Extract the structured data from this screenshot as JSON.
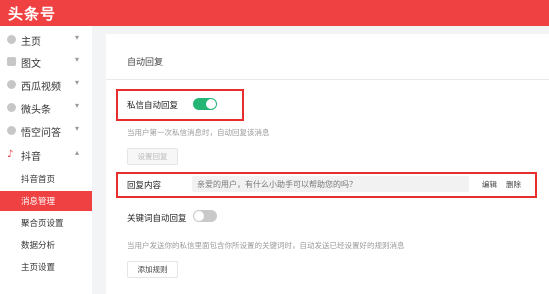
{
  "app": {
    "logo": "头条号"
  },
  "sidebar": {
    "items": [
      {
        "label": "主页",
        "icon": "home-icon",
        "caret": "▾"
      },
      {
        "label": "图文",
        "icon": "article-icon",
        "caret": "▾"
      },
      {
        "label": "西瓜视频",
        "icon": "video-icon",
        "caret": "▾"
      },
      {
        "label": "微头条",
        "icon": "micro-post-icon",
        "caret": "▾"
      },
      {
        "label": "悟空问答",
        "icon": "qa-icon",
        "caret": "▾"
      },
      {
        "label": "抖音",
        "icon": "douyin-icon",
        "caret": "▴"
      }
    ],
    "subitems": [
      {
        "label": "抖音首页",
        "active": false
      },
      {
        "label": "消息管理",
        "active": true
      },
      {
        "label": "聚合页设置",
        "active": false
      },
      {
        "label": "数据分析",
        "active": false
      },
      {
        "label": "主页设置",
        "active": false
      }
    ]
  },
  "main": {
    "title": "自动回复",
    "private_reply": {
      "label": "私信自动回复",
      "enabled": true,
      "hint": "当用户第一次私信消息时，自动回复该消息",
      "setup_button": "设置回复"
    },
    "reply_content": {
      "label": "回复内容",
      "value": "亲爱的用户，有什么小助手可以帮助您的吗？",
      "edit": "编辑",
      "delete": "删除"
    },
    "keyword_reply": {
      "label": "关键词自动回复",
      "enabled": false,
      "hint": "当用户发送你的私信里面包含你所设置的关键词时，自动发送已经设置好的规则消息",
      "add_button": "添加规则"
    }
  },
  "colors": {
    "brand": "#f04142",
    "toggle_on": "#22b573",
    "highlight": "#e62e2e"
  }
}
